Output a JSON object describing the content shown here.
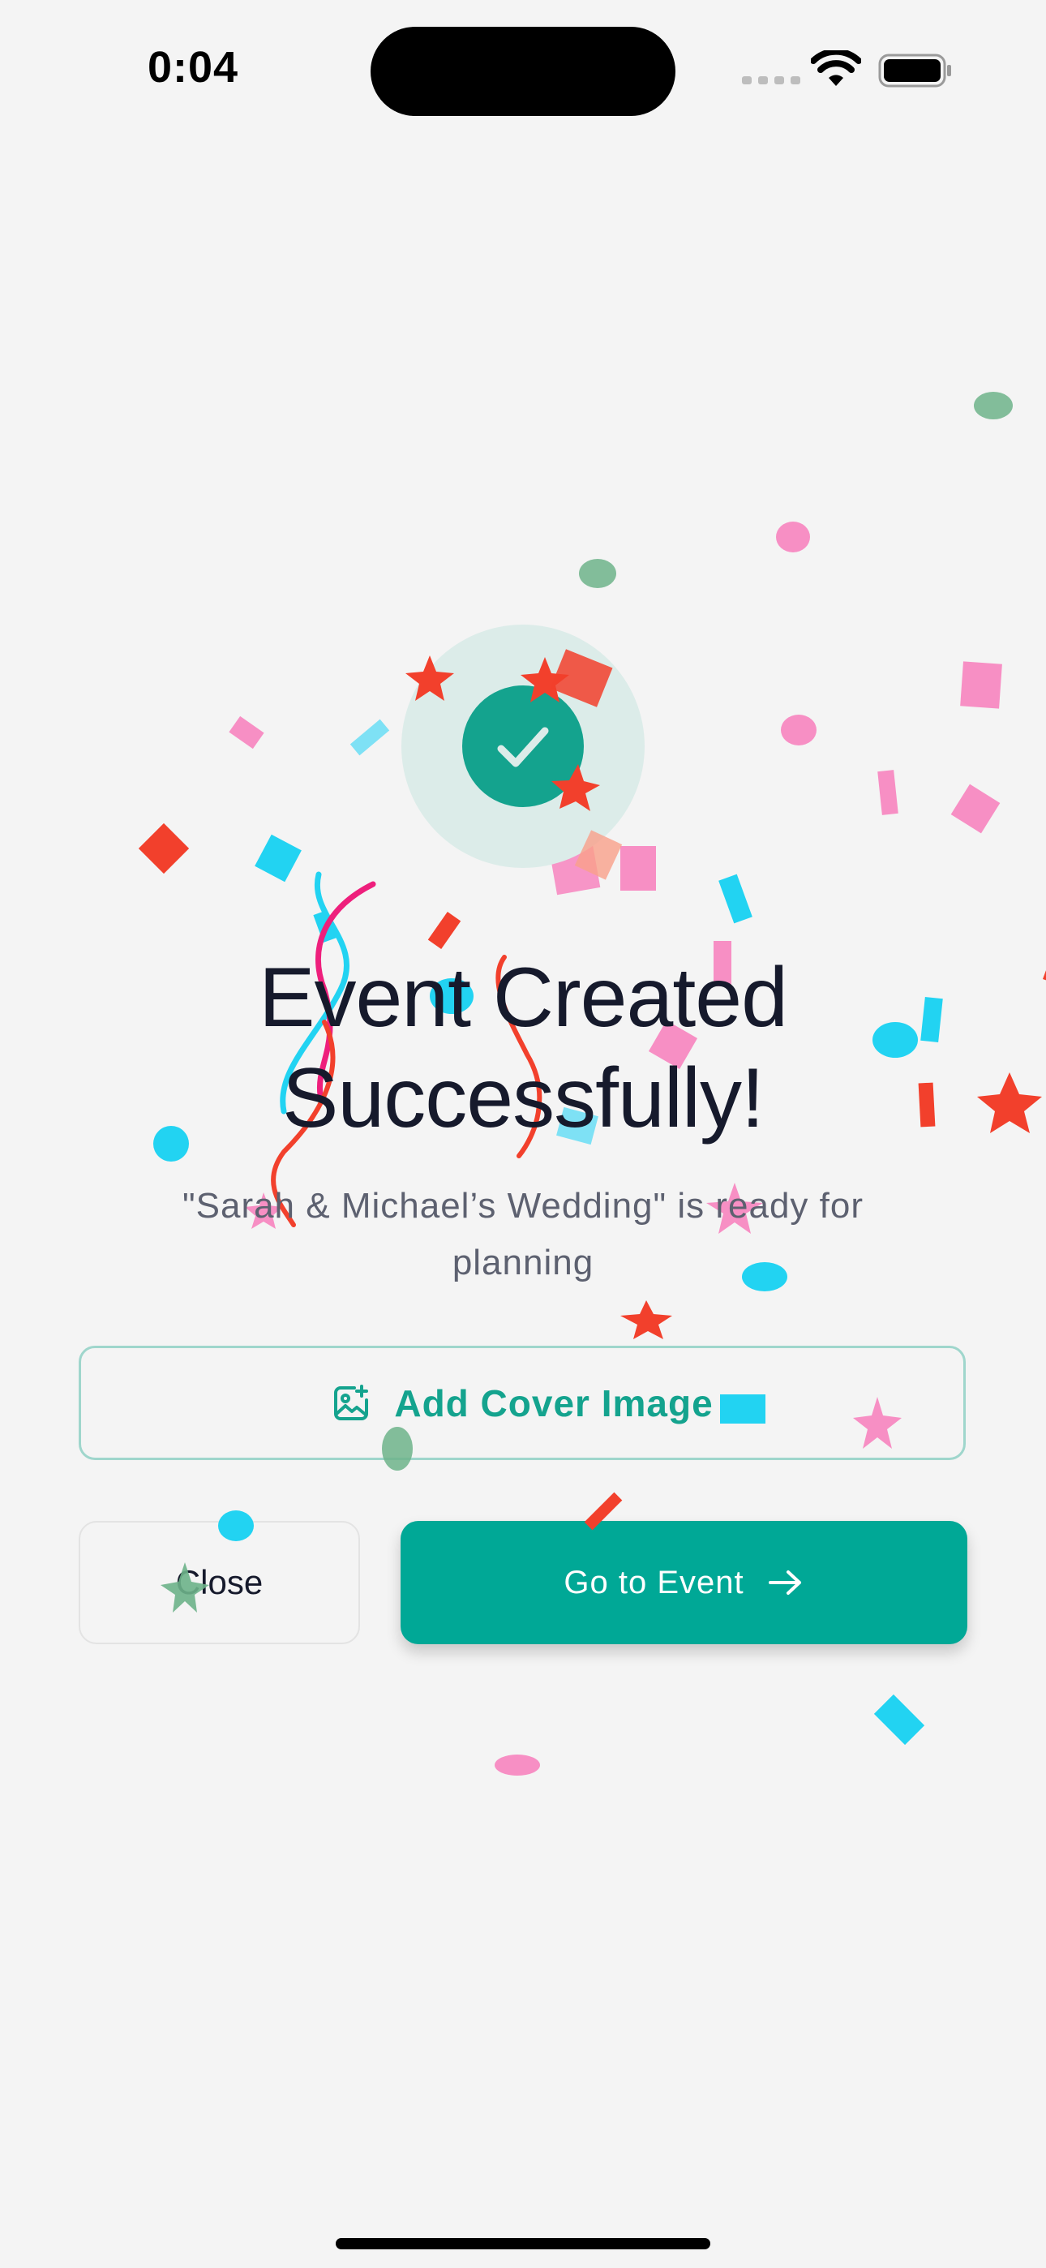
{
  "status_bar": {
    "time": "0:04"
  },
  "success": {
    "icon": "check-icon",
    "accent": "#14a38e"
  },
  "heading": {
    "line1": "Event Created",
    "line2": "Successfully!"
  },
  "subtitle": {
    "line1": "\"Sarah & Michael’s Wedding\" is ready for",
    "line2": "planning"
  },
  "actions": {
    "cover": {
      "label": "Add Cover Image",
      "icon": "image-plus-icon"
    },
    "close": {
      "label": "Close"
    },
    "go": {
      "label": "Go to Event",
      "icon": "arrow-right-icon",
      "color": "#00a896"
    }
  },
  "confetti_colors": {
    "pink": "#f78fc4",
    "red": "#f2402c",
    "cyan": "#22d3f2",
    "green": "#6db38a"
  }
}
